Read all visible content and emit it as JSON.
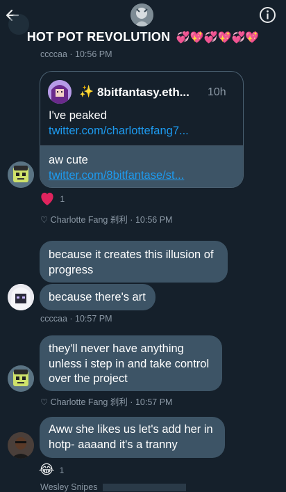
{
  "header": {
    "title": "HOT POT REVOLUTION",
    "title_emoji": "💞💖💞💖💞💖",
    "back_icon": "arrow-left-icon",
    "info_icon": "info-circle-icon"
  },
  "top_meta": {
    "sender": "ccccaa",
    "time": "· 10:56 PM"
  },
  "quoted_tweet": {
    "badge": "✨",
    "author": "8bitfantasy.eth...",
    "age": "10h",
    "text_prefix": "I've peaked ",
    "link": "twitter.com/charlottefang7..."
  },
  "reply_bubble": {
    "text_prefix": "aw cute ",
    "link": "twitter.com/8bitfantase/st..."
  },
  "reaction_1": {
    "emoji": "❤️",
    "count": "1"
  },
  "like_meta_1": {
    "text": "♡ Charlotte Fang 刹利 · 10:56 PM"
  },
  "messages": {
    "m1": "because it creates this illusion of progress",
    "m2": "because there's art",
    "m2_meta": "ccccaa · 10:57 PM",
    "m3": "they'll never have anything unless i step in and take control over the project",
    "m3_meta": "♡ Charlotte Fang 刹利 · 10:57 PM",
    "m4": "Aww she likes us let's add her in hotp- aaaand it's a tranny",
    "m4_reaction": "😂",
    "m4_reaction_count": "1",
    "bottom_meta": "Wesley Snipes"
  },
  "colors": {
    "background": "#15202b",
    "bubble": "#3d5466",
    "link": "#1d9bf0",
    "meta": "#8b98a5",
    "heart": "#f91880"
  }
}
